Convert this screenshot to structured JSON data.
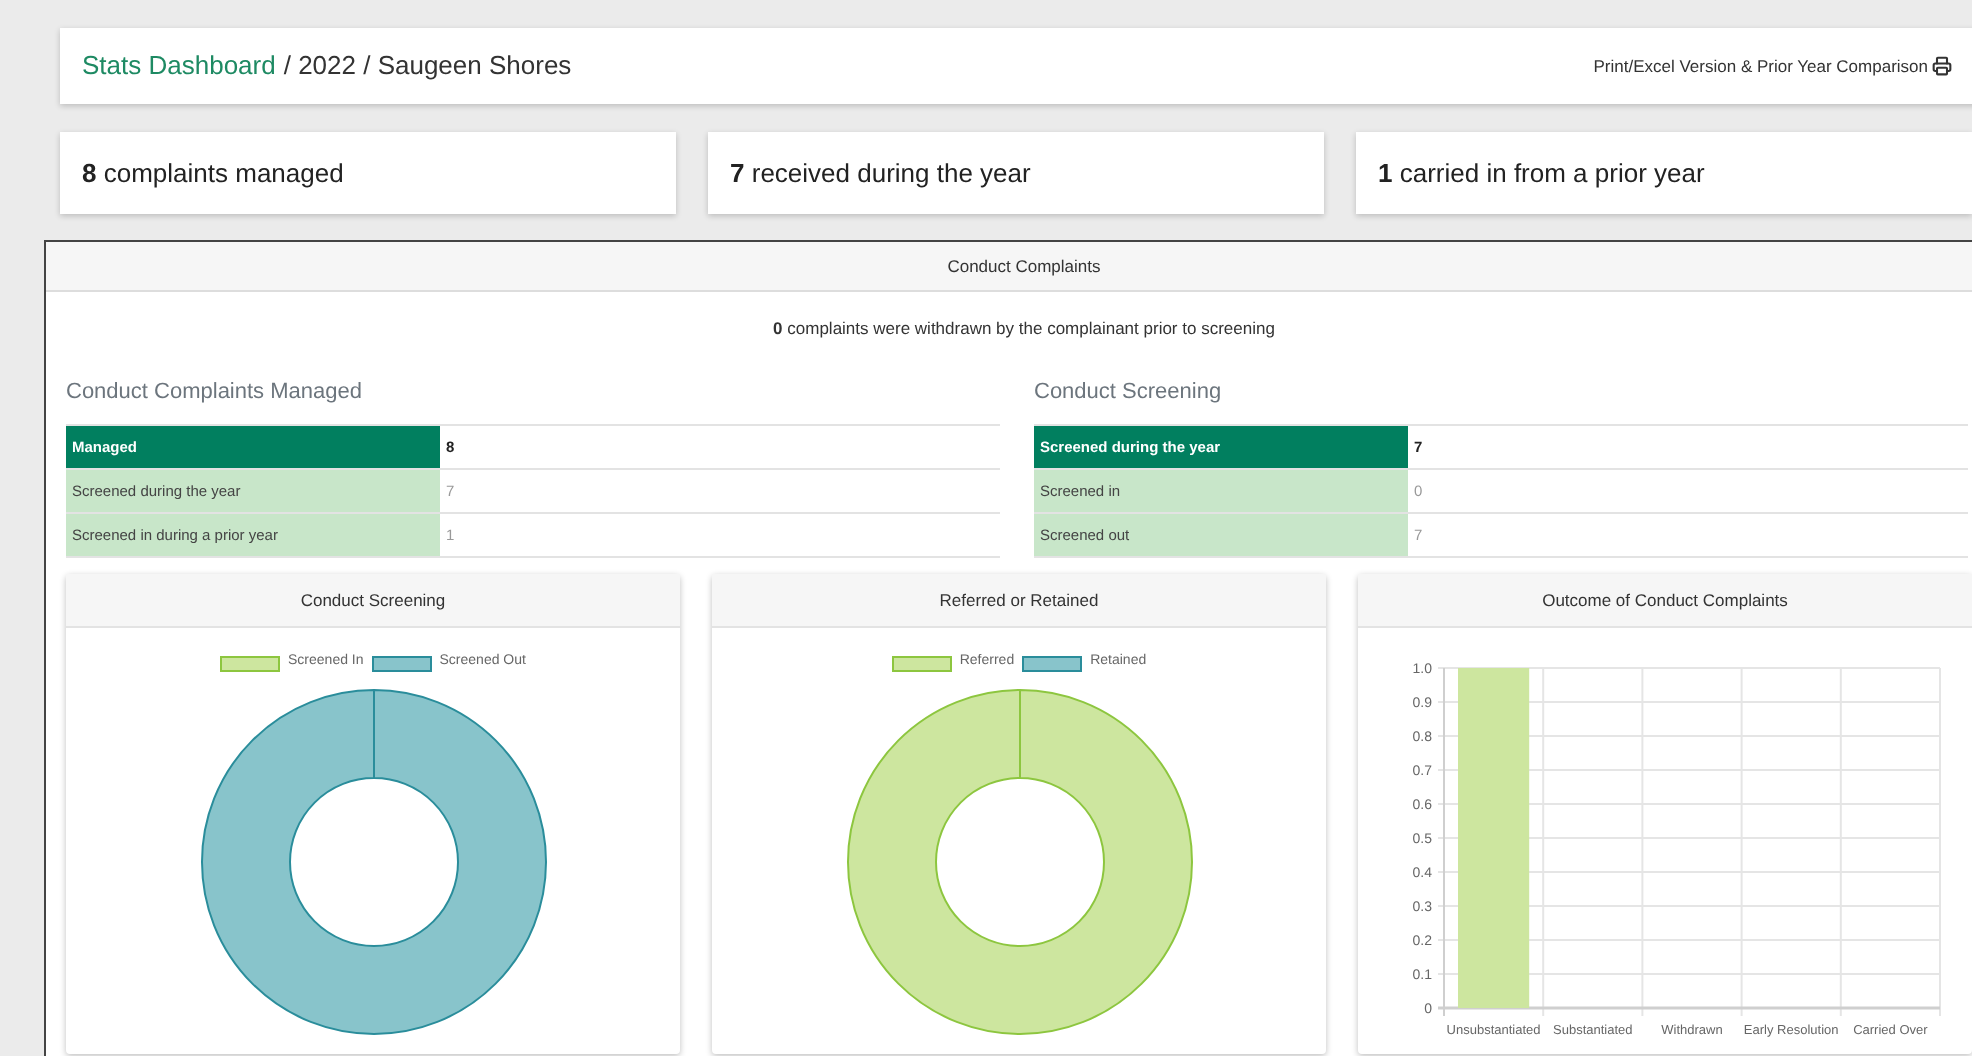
{
  "breadcrumb": {
    "link": "Stats Dashboard",
    "rest": "/ 2022 / Saugeen Shores"
  },
  "print_link": "Print/Excel Version & Prior Year Comparison",
  "summary": [
    {
      "number": "8",
      "text": "complaints managed"
    },
    {
      "number": "7",
      "text": "received during the year"
    },
    {
      "number": "1",
      "text": "carried in from a prior year"
    }
  ],
  "panel": {
    "title": "Conduct Complaints",
    "note": "**0** complaints were withdrawn by the complainant prior to screening",
    "tables": [
      {
        "title": "Conduct Complaints Managed",
        "rows": [
          {
            "kind": "header",
            "label": "Managed",
            "value": "8"
          },
          {
            "kind": "row",
            "label": "Screened during the year",
            "value": "7"
          },
          {
            "kind": "row",
            "label": "Screened in during a prior year",
            "value": "1"
          }
        ]
      },
      {
        "title": "Conduct Screening",
        "rows": [
          {
            "kind": "header",
            "label": "Screened during the year",
            "value": "7"
          },
          {
            "kind": "row",
            "label": "Screened in",
            "value": "0"
          },
          {
            "kind": "row",
            "label": "Screened out",
            "value": "7"
          }
        ]
      }
    ],
    "charts": [
      {
        "title": "Conduct Screening",
        "chart_data": {
          "type": "donut",
          "categories": [
            "Screened In",
            "Screened Out"
          ],
          "values": [
            0,
            100
          ],
          "colors": [
            "#cde69f",
            "#88c4cb"
          ]
        }
      },
      {
        "title": "Referred or Retained",
        "chart_data": {
          "type": "donut",
          "categories": [
            "Referred",
            "Retained"
          ],
          "values": [
            100,
            0
          ],
          "colors": [
            "#cde69f",
            "#88c4cb"
          ]
        }
      },
      {
        "title": "Outcome of Conduct Complaints",
        "chart_data": {
          "type": "bar",
          "categories": [
            "Unsubstantiated",
            "Substantiated",
            "Withdrawn",
            "Early Resolution",
            "Carried Over"
          ],
          "series": [
            {
              "color": "#cde69f",
              "values": [
                1,
                0,
                0,
                0,
                0
              ]
            }
          ],
          "ylim": [
            0,
            1
          ],
          "grid": true,
          "yticks": [
            0,
            0.1,
            0.2,
            0.3,
            0.4,
            0.5,
            0.6,
            0.7,
            0.8,
            0.9,
            {
              "value": 1,
              "label": "1.0"
            }
          ]
        }
      }
    ]
  }
}
